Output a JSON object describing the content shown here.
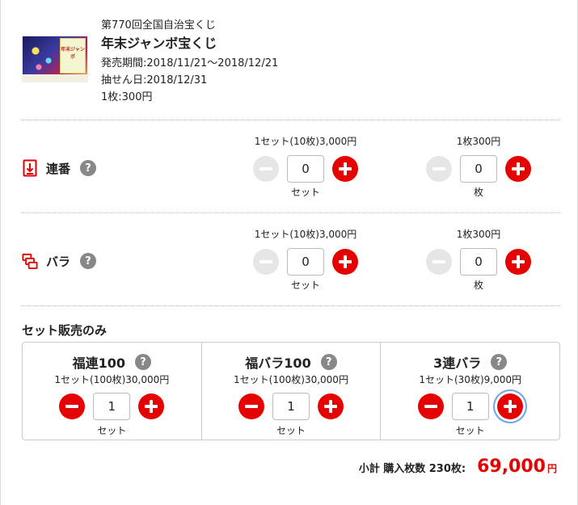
{
  "product": {
    "round": "第770回全国自治宝くじ",
    "title": "年末ジャンボ宝くじ",
    "sale_period": "発売期間:2018/11/21〜2018/12/21",
    "draw_date": "抽せん日:2018/12/31",
    "unit_price": "1枚:300円",
    "thumb_text": "年末ジャンボ"
  },
  "rows": [
    {
      "label": "連番",
      "icon": "renban-icon",
      "set": {
        "price": "1セット(10枚)3,000円",
        "value": "0",
        "unit": "セット"
      },
      "single": {
        "price": "1枚300円",
        "value": "0",
        "unit": "枚"
      }
    },
    {
      "label": "バラ",
      "icon": "bara-icon",
      "set": {
        "price": "1セット(10枚)3,000円",
        "value": "0",
        "unit": "セット"
      },
      "single": {
        "price": "1枚300円",
        "value": "0",
        "unit": "枚"
      }
    }
  ],
  "set_sales": {
    "title": "セット販売のみ",
    "items": [
      {
        "name": "福連100",
        "price": "1セット(100枚)30,000円",
        "value": "1",
        "unit": "セット"
      },
      {
        "name": "福バラ100",
        "price": "1セット(100枚)30,000円",
        "value": "1",
        "unit": "セット"
      },
      {
        "name": "3連バラ",
        "price": "1セット(30枚)9,000円",
        "value": "1",
        "unit": "セット"
      }
    ]
  },
  "help_glyph": "?",
  "subtotal": {
    "label": "小計 購入枚数 230枚:",
    "amount": "69,000",
    "currency": "円"
  },
  "colors": {
    "accent": "#e60000",
    "disabled": "#e6e6e6",
    "help": "#888888",
    "focus": "#6aa6ea"
  }
}
